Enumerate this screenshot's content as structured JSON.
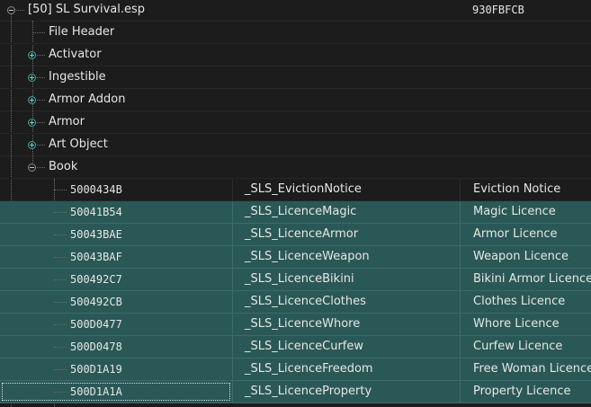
{
  "plugin": {
    "label": "[50] SL Survival.esp",
    "formid_prefix": "930FBFCB"
  },
  "groups": [
    {
      "label": "File Header",
      "has_children": false
    },
    {
      "label": "Activator",
      "has_children": true,
      "expanded": false
    },
    {
      "label": "Ingestible",
      "has_children": true,
      "expanded": false
    },
    {
      "label": "Armor Addon",
      "has_children": true,
      "expanded": false
    },
    {
      "label": "Armor",
      "has_children": true,
      "expanded": false
    },
    {
      "label": "Art Object",
      "has_children": true,
      "expanded": false
    },
    {
      "label": "Book",
      "has_children": true,
      "expanded": true
    }
  ],
  "book_records": [
    {
      "formid": "5000434B",
      "edid": "_SLS_EvictionNotice",
      "name": "Eviction Notice",
      "selected": false
    },
    {
      "formid": "50041B54",
      "edid": "_SLS_LicenceMagic",
      "name": "Magic Licence",
      "selected": true
    },
    {
      "formid": "50043BAE",
      "edid": "_SLS_LicenceArmor",
      "name": "Armor Licence",
      "selected": true
    },
    {
      "formid": "50043BAF",
      "edid": "_SLS_LicenceWeapon",
      "name": "Weapon Licence",
      "selected": true
    },
    {
      "formid": "500492C7",
      "edid": "_SLS_LicenceBikini",
      "name": "Bikini Armor Licence",
      "selected": true
    },
    {
      "formid": "500492CB",
      "edid": "_SLS_LicenceClothes",
      "name": "Clothes Licence",
      "selected": true
    },
    {
      "formid": "500D0477",
      "edid": "_SLS_LicenceWhore",
      "name": "Whore Licence",
      "selected": true
    },
    {
      "formid": "500D0478",
      "edid": "_SLS_LicenceCurfew",
      "name": "Curfew Licence",
      "selected": true
    },
    {
      "formid": "500D1A19",
      "edid": "_SLS_LicenceFreedom",
      "name": "Free Woman Licence",
      "selected": true
    },
    {
      "formid": "500D1A1A",
      "edid": "_SLS_LicenceProperty",
      "name": "Property Licence",
      "selected": true,
      "focused": true
    }
  ],
  "colors": {
    "background": "#1c1c1c",
    "selection": "#2a5856",
    "text": "#e6e6e6",
    "expander_accent": "#3fa9a0"
  },
  "icons": {
    "collapse": "minus-circle-icon",
    "expand": "plus-circle-icon"
  }
}
